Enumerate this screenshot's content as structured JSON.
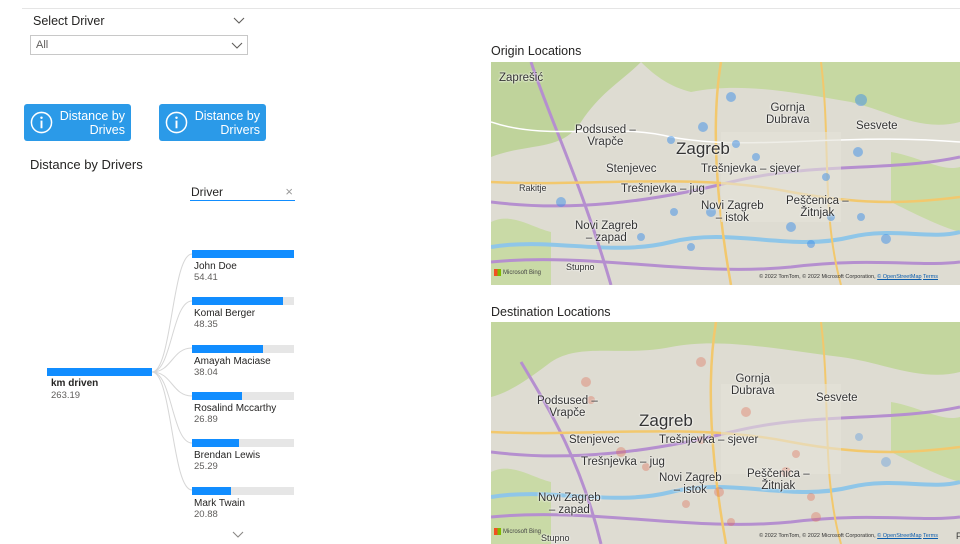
{
  "slicer": {
    "title": "Select Driver",
    "value": "All"
  },
  "buttons": [
    {
      "line1": "Distance by",
      "line2": "Drives"
    },
    {
      "line1": "Distance by",
      "line2": "Drivers"
    }
  ],
  "decomposition": {
    "title": "Distance by Drivers",
    "field": "Driver",
    "root": {
      "label": "km driven",
      "value": "263.19"
    },
    "nodes": [
      {
        "name": "John Doe",
        "value": "54.41",
        "fraction": 1.0
      },
      {
        "name": "Komal Berger",
        "value": "48.35",
        "fraction": 0.889
      },
      {
        "name": "Amayah Maciase",
        "value": "38.04",
        "fraction": 0.699
      },
      {
        "name": "Rosalind Mccarthy",
        "value": "26.89",
        "fraction": 0.494
      },
      {
        "name": "Brendan Lewis",
        "value": "25.29",
        "fraction": 0.465
      },
      {
        "name": "Mark Twain",
        "value": "20.88",
        "fraction": 0.384
      }
    ]
  },
  "maps": {
    "origin": {
      "title": "Origin Locations",
      "bubble_color": "#4a90e2",
      "labels": {
        "zapresic": "Zaprešić",
        "podsused": "Podsused –\nVrapče",
        "zagreb": "Zagreb",
        "gornja": "Gornja\nDubrava",
        "sesvete": "Sesvete",
        "stenjevec": "Stenjevec",
        "tresnjevka_sjever": "Trešnjevka – sjever",
        "rakitje": "Rakitje",
        "tresnjevka_jug": "Trešnjevka – jug",
        "novi_zagreb_istok": "Novi Zagreb\n– istok",
        "pescenica": "Peščenica –\nŽitnjak",
        "novi_zagreb_zapad": "Novi Zagreb\n– zapad",
        "stupno": "Stupno"
      },
      "bing": "Microsoft Bing",
      "copyright": "© 2022 TomTom, © 2022 Microsoft Corporation,",
      "osm": "© OpenStreetMap",
      "terms": "Terms"
    },
    "destination": {
      "title": "Destination Locations",
      "bubble_color": "#e8826a",
      "labels": {
        "podsused": "Podsused –\nVrapče",
        "zagreb": "Zagreb",
        "gornja": "Gornja\nDubrava",
        "sesvete": "Sesvete",
        "stenjevec": "Stenjevec",
        "tresnjevka_sjever": "Trešnjevka – sjever",
        "tresnjevka_jug": "Trešnjevka – jug",
        "novi_zagreb_istok": "Novi Zagreb\n– istok",
        "pescenica": "Peščenica –\nŽitnjak",
        "novi_zagreb_zapad": "Novi Zagreb\n– zapad",
        "stupno": "Stupno"
      },
      "bing": "Microsoft Bing",
      "copyright": "© 2022 TomTom, © 2022 Microsoft Corporation,",
      "osm": "© OpenStreetMap",
      "terms": "Terms",
      "edge_text": "P"
    }
  }
}
